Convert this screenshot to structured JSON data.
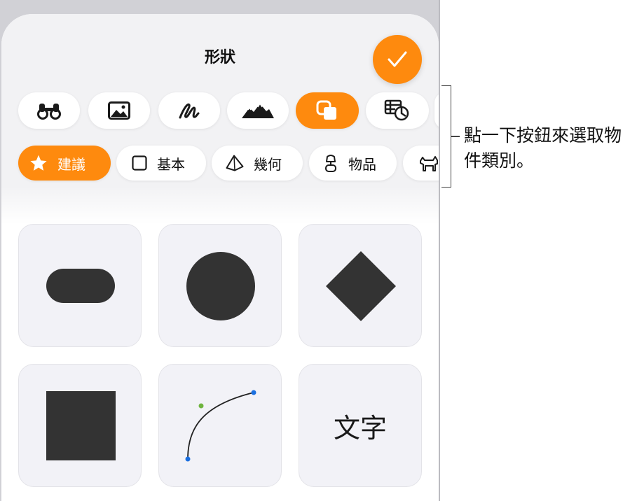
{
  "panel": {
    "title": "形狀",
    "done_icon": "checkmark-icon"
  },
  "categories": [
    {
      "name": "binoculars-icon",
      "active": false
    },
    {
      "name": "photo-icon",
      "active": false
    },
    {
      "name": "scribble-icon",
      "active": false
    },
    {
      "name": "mountains-icon",
      "active": false
    },
    {
      "name": "shapes-icon",
      "active": true
    },
    {
      "name": "table-chart-icon",
      "active": false
    }
  ],
  "chips": [
    {
      "label": "建議",
      "icon": "star-icon",
      "active": true
    },
    {
      "label": "基本",
      "icon": "square-outline-icon",
      "active": false
    },
    {
      "label": "幾何",
      "icon": "pyramid-icon",
      "active": false
    },
    {
      "label": "物品",
      "icon": "lamp-icon",
      "active": false
    },
    {
      "label": "",
      "icon": "animal-icon",
      "active": false
    }
  ],
  "shapes": [
    {
      "name": "rounded-rectangle-shape"
    },
    {
      "name": "circle-shape"
    },
    {
      "name": "diamond-shape"
    },
    {
      "name": "square-shape"
    },
    {
      "name": "curve-line-shape"
    },
    {
      "name": "text-shape",
      "label": "文字"
    }
  ],
  "callout": {
    "text": "點一下按鈕來選取物件類別。"
  },
  "colors": {
    "accent": "#fe8a0e",
    "shape_fill": "#333333",
    "tile_bg": "#f2f2f7",
    "curve_start_point": "#6fb43f",
    "curve_end_point": "#1a6fe0"
  }
}
